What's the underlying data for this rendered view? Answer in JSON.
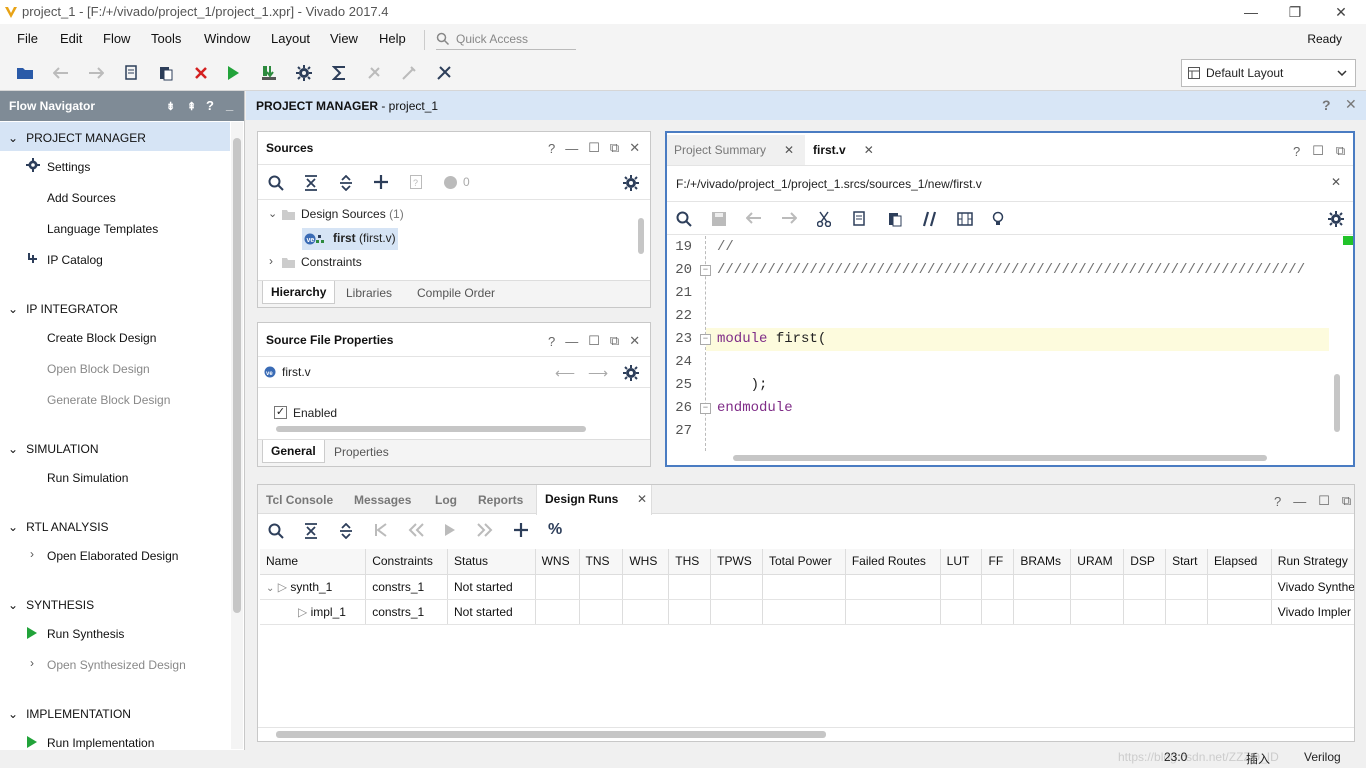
{
  "window": {
    "title": "project_1 - [F:/+/vivado/project_1/project_1.xpr] - Vivado 2017.4",
    "minimize": "—",
    "restore": "❐",
    "close": "✕"
  },
  "menu": {
    "items": [
      "File",
      "Edit",
      "Flow",
      "Tools",
      "Window",
      "Layout",
      "View",
      "Help"
    ],
    "quick_access_placeholder": "Quick Access",
    "status": "Ready"
  },
  "toolbar": {
    "layout_select": "Default Layout"
  },
  "flow_navigator": {
    "title": "Flow Navigator",
    "sections": [
      {
        "label": "PROJECT MANAGER",
        "items": [
          "Settings",
          "Add Sources",
          "Language Templates",
          "IP Catalog"
        ]
      },
      {
        "label": "IP INTEGRATOR",
        "items": [
          "Create Block Design",
          "Open Block Design",
          "Generate Block Design"
        ]
      },
      {
        "label": "SIMULATION",
        "items": [
          "Run Simulation"
        ]
      },
      {
        "label": "RTL ANALYSIS",
        "items": [
          "Open Elaborated Design"
        ]
      },
      {
        "label": "SYNTHESIS",
        "items": [
          "Run Synthesis",
          "Open Synthesized Design"
        ]
      },
      {
        "label": "IMPLEMENTATION",
        "items": [
          "Run Implementation"
        ]
      }
    ]
  },
  "project_manager": {
    "title_bold": "PROJECT MANAGER",
    "title_rest": " - project_1"
  },
  "sources": {
    "title": "Sources",
    "count": "0",
    "tree": {
      "design_sources": "Design Sources",
      "design_sources_count": "(1)",
      "file_bold": "first",
      "file_rest": " (first.v)",
      "constraints": "Constraints"
    },
    "tabs": [
      "Hierarchy",
      "Libraries",
      "Compile Order"
    ]
  },
  "source_file_properties": {
    "title": "Source File Properties",
    "file": "first.v",
    "enabled_label": "Enabled",
    "tabs": [
      "General",
      "Properties"
    ]
  },
  "editor": {
    "tabs": [
      "Project Summary",
      "first.v"
    ],
    "path": "F:/+/vivado/project_1/project_1.srcs/sources_1/new/first.v",
    "lines": [
      {
        "num": "19",
        "text": "//"
      },
      {
        "num": "20",
        "text": "//////////////////////////////////////////////////////////////////////"
      },
      {
        "num": "21",
        "text": ""
      },
      {
        "num": "22",
        "text": ""
      },
      {
        "num": "23",
        "kw": "module",
        "text": " first("
      },
      {
        "num": "24",
        "text": ""
      },
      {
        "num": "25",
        "text": "    );"
      },
      {
        "num": "26",
        "kw": "endmodule",
        "text": ""
      },
      {
        "num": "27",
        "text": ""
      }
    ]
  },
  "bottom_panel": {
    "tabs": [
      "Tcl Console",
      "Messages",
      "Log",
      "Reports",
      "Design Runs"
    ],
    "columns": [
      "Name",
      "Constraints",
      "Status",
      "WNS",
      "TNS",
      "WHS",
      "THS",
      "TPWS",
      "Total Power",
      "Failed Routes",
      "LUT",
      "FF",
      "BRAMs",
      "URAM",
      "DSP",
      "Start",
      "Elapsed",
      "Run Strategy"
    ],
    "rows": [
      {
        "name": "synth_1",
        "constraints": "constrs_1",
        "status": "Not started",
        "strategy": "Vivado Synthe"
      },
      {
        "name": "impl_1",
        "constraints": "constrs_1",
        "status": "Not started",
        "strategy": "Vivado Impler"
      }
    ]
  },
  "statusbar": {
    "position": "23:0",
    "mode": "插入",
    "language": "Verilog",
    "watermark": "https://blog.csdn.net/ZZZO_ID"
  }
}
